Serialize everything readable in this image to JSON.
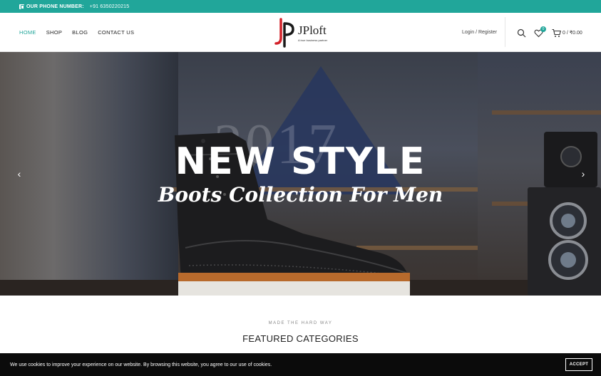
{
  "topbar": {
    "phone_label": "OUR PHONE NUMBER:",
    "phone_number": "+91 6350220215",
    "icon": "phone-icon"
  },
  "nav": {
    "items": [
      {
        "label": "HOME",
        "active": true
      },
      {
        "label": "SHOP",
        "active": false
      },
      {
        "label": "BLOG",
        "active": false
      },
      {
        "label": "CONTACT US",
        "active": false
      }
    ]
  },
  "logo": {
    "brand": "JPloft",
    "tagline": "A true business partner"
  },
  "header": {
    "login_label": "Login / Register",
    "wishlist_count": "0",
    "cart_text": "0 / ₹0.00",
    "icons": [
      "search-icon",
      "heart-icon",
      "cart-icon"
    ]
  },
  "hero": {
    "title": "NEW STYLE",
    "subtitle": "Boots Collection For Men",
    "background_text": "2017",
    "prev_arrow": "‹",
    "next_arrow": "›"
  },
  "featured": {
    "eyebrow": "MADE THE HARD WAY",
    "title": "FEATURED CATEGORIES"
  },
  "cookie": {
    "message": "We use cookies to improve your experience on our website. By browsing this website, you agree to our use of cookies.",
    "accept_label": "ACCEPT"
  },
  "colors": {
    "accent": "#21a69a",
    "logo_red": "#d3222a",
    "cookie_bg": "#0b0b0b"
  }
}
